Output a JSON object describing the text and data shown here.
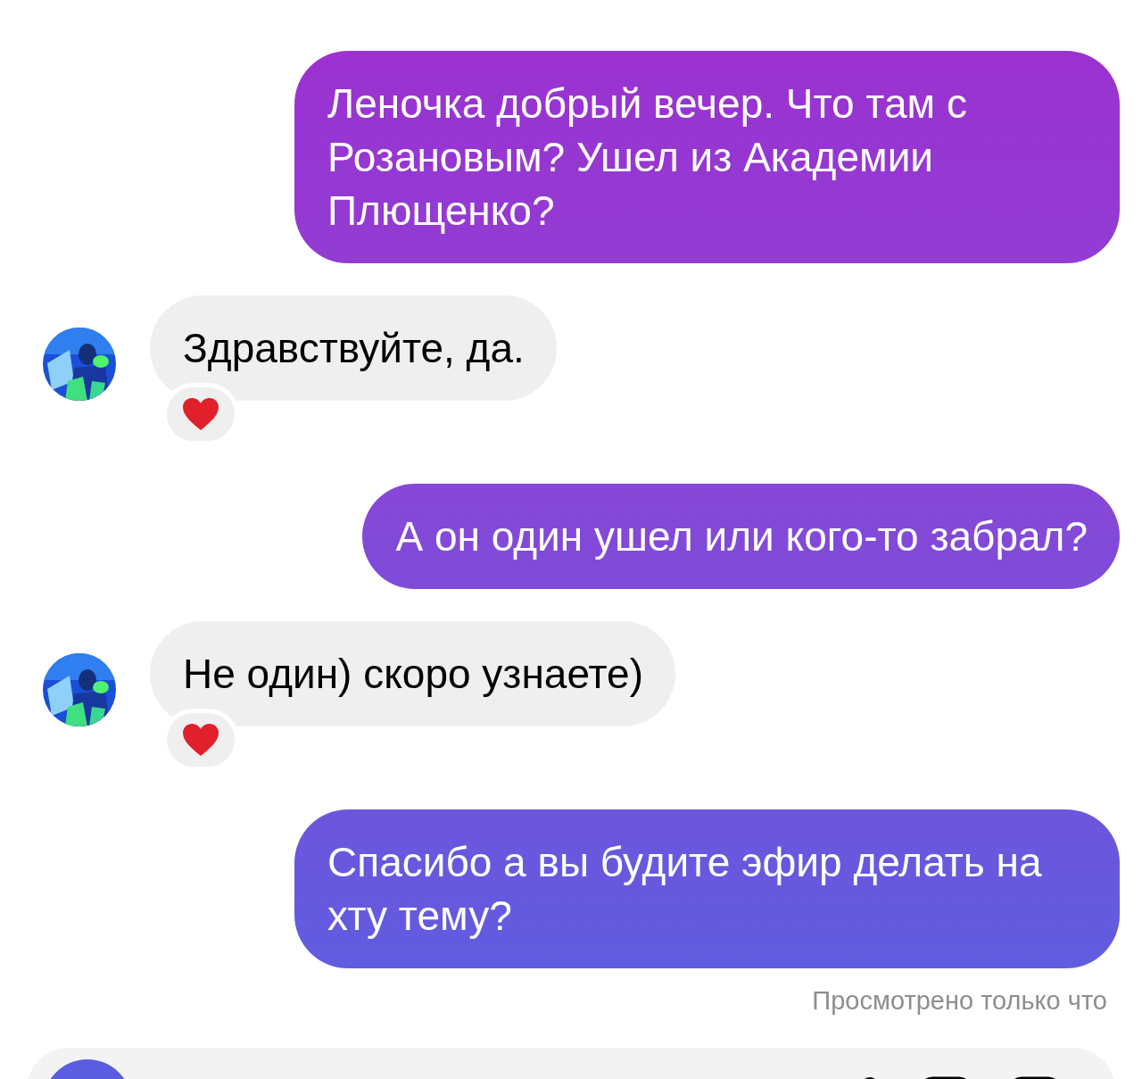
{
  "messages": [
    {
      "kind": "sent",
      "text": "Леночка добрый вечер. Что там с Розановым? Ушел из Академии Плющенко?"
    },
    {
      "kind": "received",
      "text": "Здравствуйте, да.",
      "reacted": true
    },
    {
      "kind": "sent",
      "text": "А он один ушел или кого-то забрал?"
    },
    {
      "kind": "received",
      "text": "Не один) скоро узнаете)",
      "reacted": true
    },
    {
      "kind": "sent",
      "text": "Спасибо а вы будите эфир делать на хту тему?"
    }
  ],
  "seen_status": "Просмотрено только что"
}
